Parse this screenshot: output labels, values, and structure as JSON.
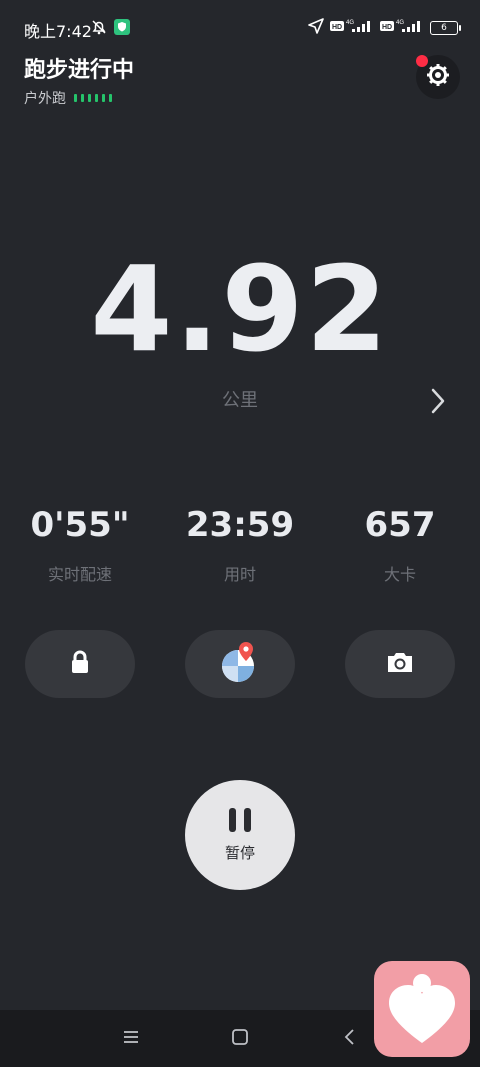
{
  "status_bar": {
    "time": "晚上7:42",
    "icons": [
      "bell-off-icon",
      "shield-icon",
      "location-arrow-icon",
      "hd-icon",
      "signal-4g-icon",
      "hd-icon",
      "signal-4g-icon"
    ],
    "battery_level": "6"
  },
  "header": {
    "title": "跑步进行中",
    "subtitle": "户外跑",
    "gps_signal_color": "#25c46b",
    "notification_dot_color": "#ff2d45"
  },
  "main": {
    "distance_value": "4.92",
    "distance_unit": "公里"
  },
  "stats": [
    {
      "value": "0'55\"",
      "label": "实时配速"
    },
    {
      "value": "23:59",
      "label": "用时"
    },
    {
      "value": "657",
      "label": "大卡"
    }
  ],
  "actions": {
    "lock_icon": "lock-icon",
    "map_icon": "map-pin-icon",
    "camera_icon": "camera-icon"
  },
  "pause": {
    "label": "暂停"
  },
  "nav": {
    "items": [
      "menu-icon",
      "home-square-icon",
      "back-icon"
    ]
  },
  "colors": {
    "background": "#25272c",
    "button_bg": "#36383d",
    "floating_app_bg": "#f29ea6"
  }
}
